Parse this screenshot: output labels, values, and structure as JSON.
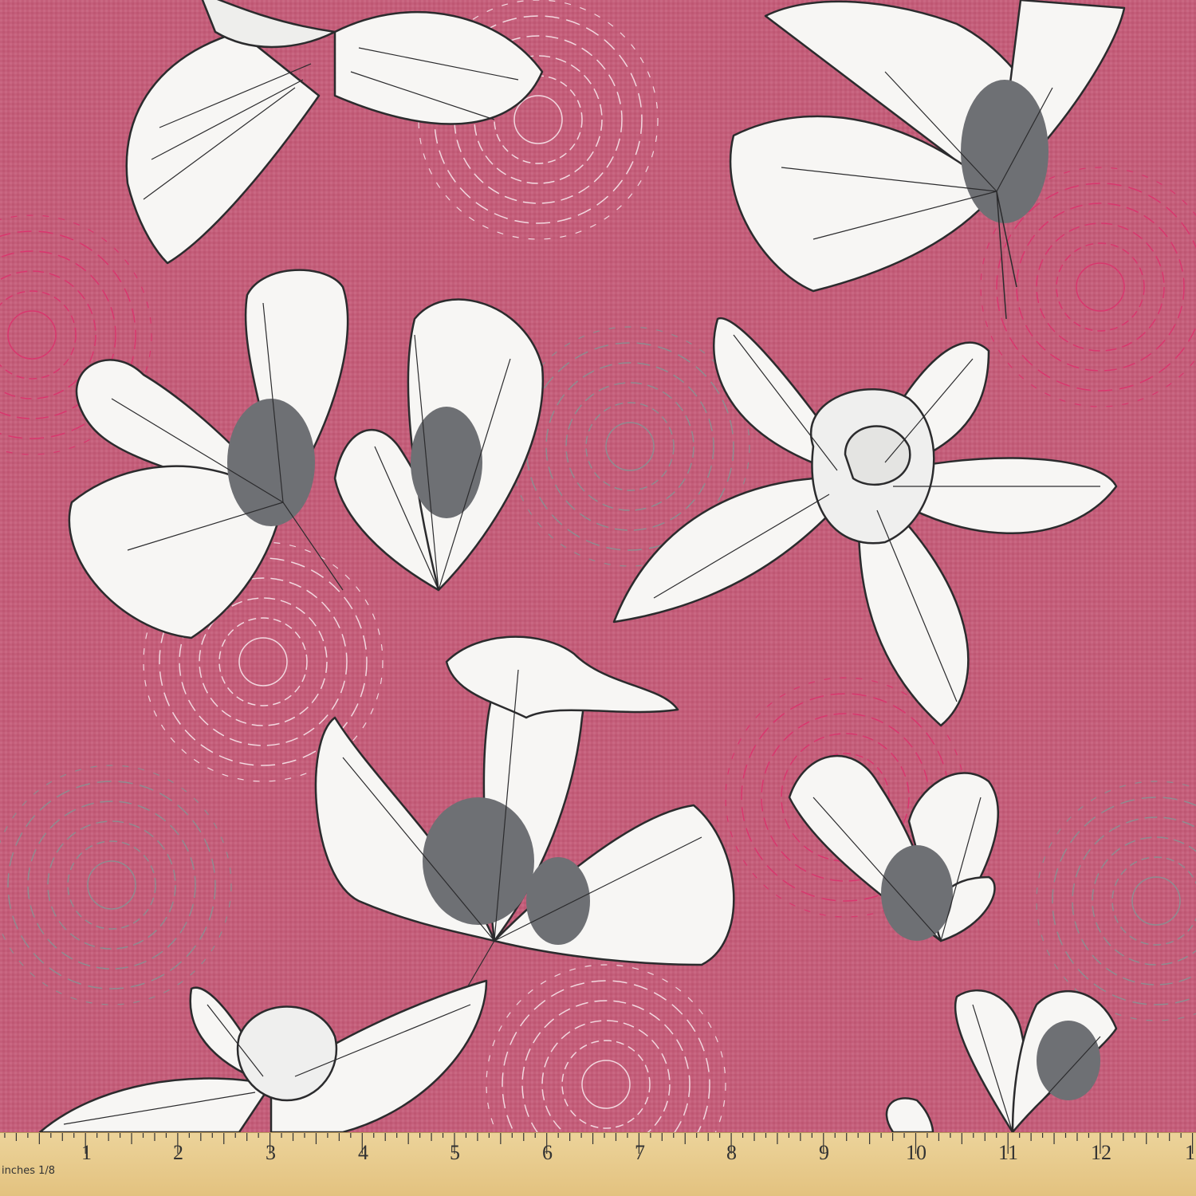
{
  "image": {
    "subject": "fabric swatch with orchid pattern",
    "colors": {
      "background": "#c45e7a",
      "petal_fill": "#f7f6f4",
      "petal_shadow": "#6e7074",
      "outline": "#2b2b2d",
      "doodle_dark_pink": "#d9366e",
      "doodle_white": "#f2d7df",
      "doodle_gray": "#8d8d91",
      "ruler": "#e8cc8e"
    }
  },
  "ruler": {
    "unit_label": "inches 1/8",
    "numbers": [
      "1",
      "2",
      "3",
      "4",
      "5",
      "6",
      "7",
      "8",
      "9",
      "10",
      "11",
      "12",
      "1"
    ]
  }
}
